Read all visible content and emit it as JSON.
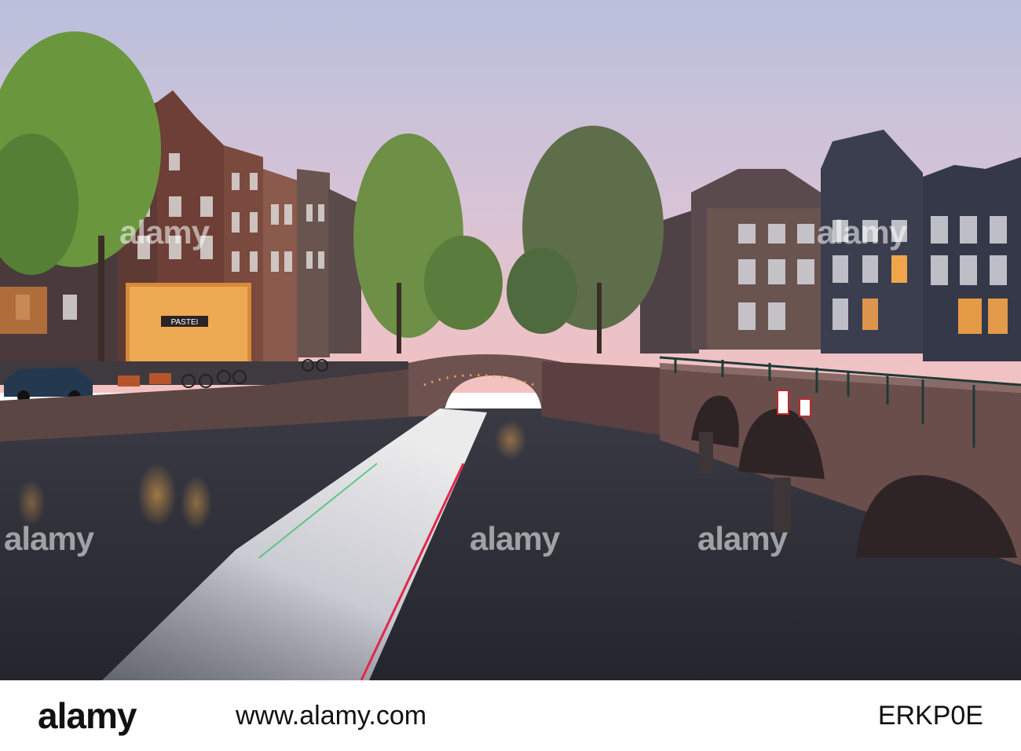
{
  "photo": {
    "watermark_text": "alamy",
    "sign_text": "PASTEI"
  },
  "footer": {
    "logo_text": "alamy",
    "domain_text": "www.alamy.com",
    "image_id": "ERKP0E"
  },
  "colors": {
    "sky_top": "#c3c8e0",
    "sky_bottom": "#f2bfc0",
    "water": "#2b2d37",
    "brick": "#6b4a44",
    "light": "#f5a545"
  }
}
